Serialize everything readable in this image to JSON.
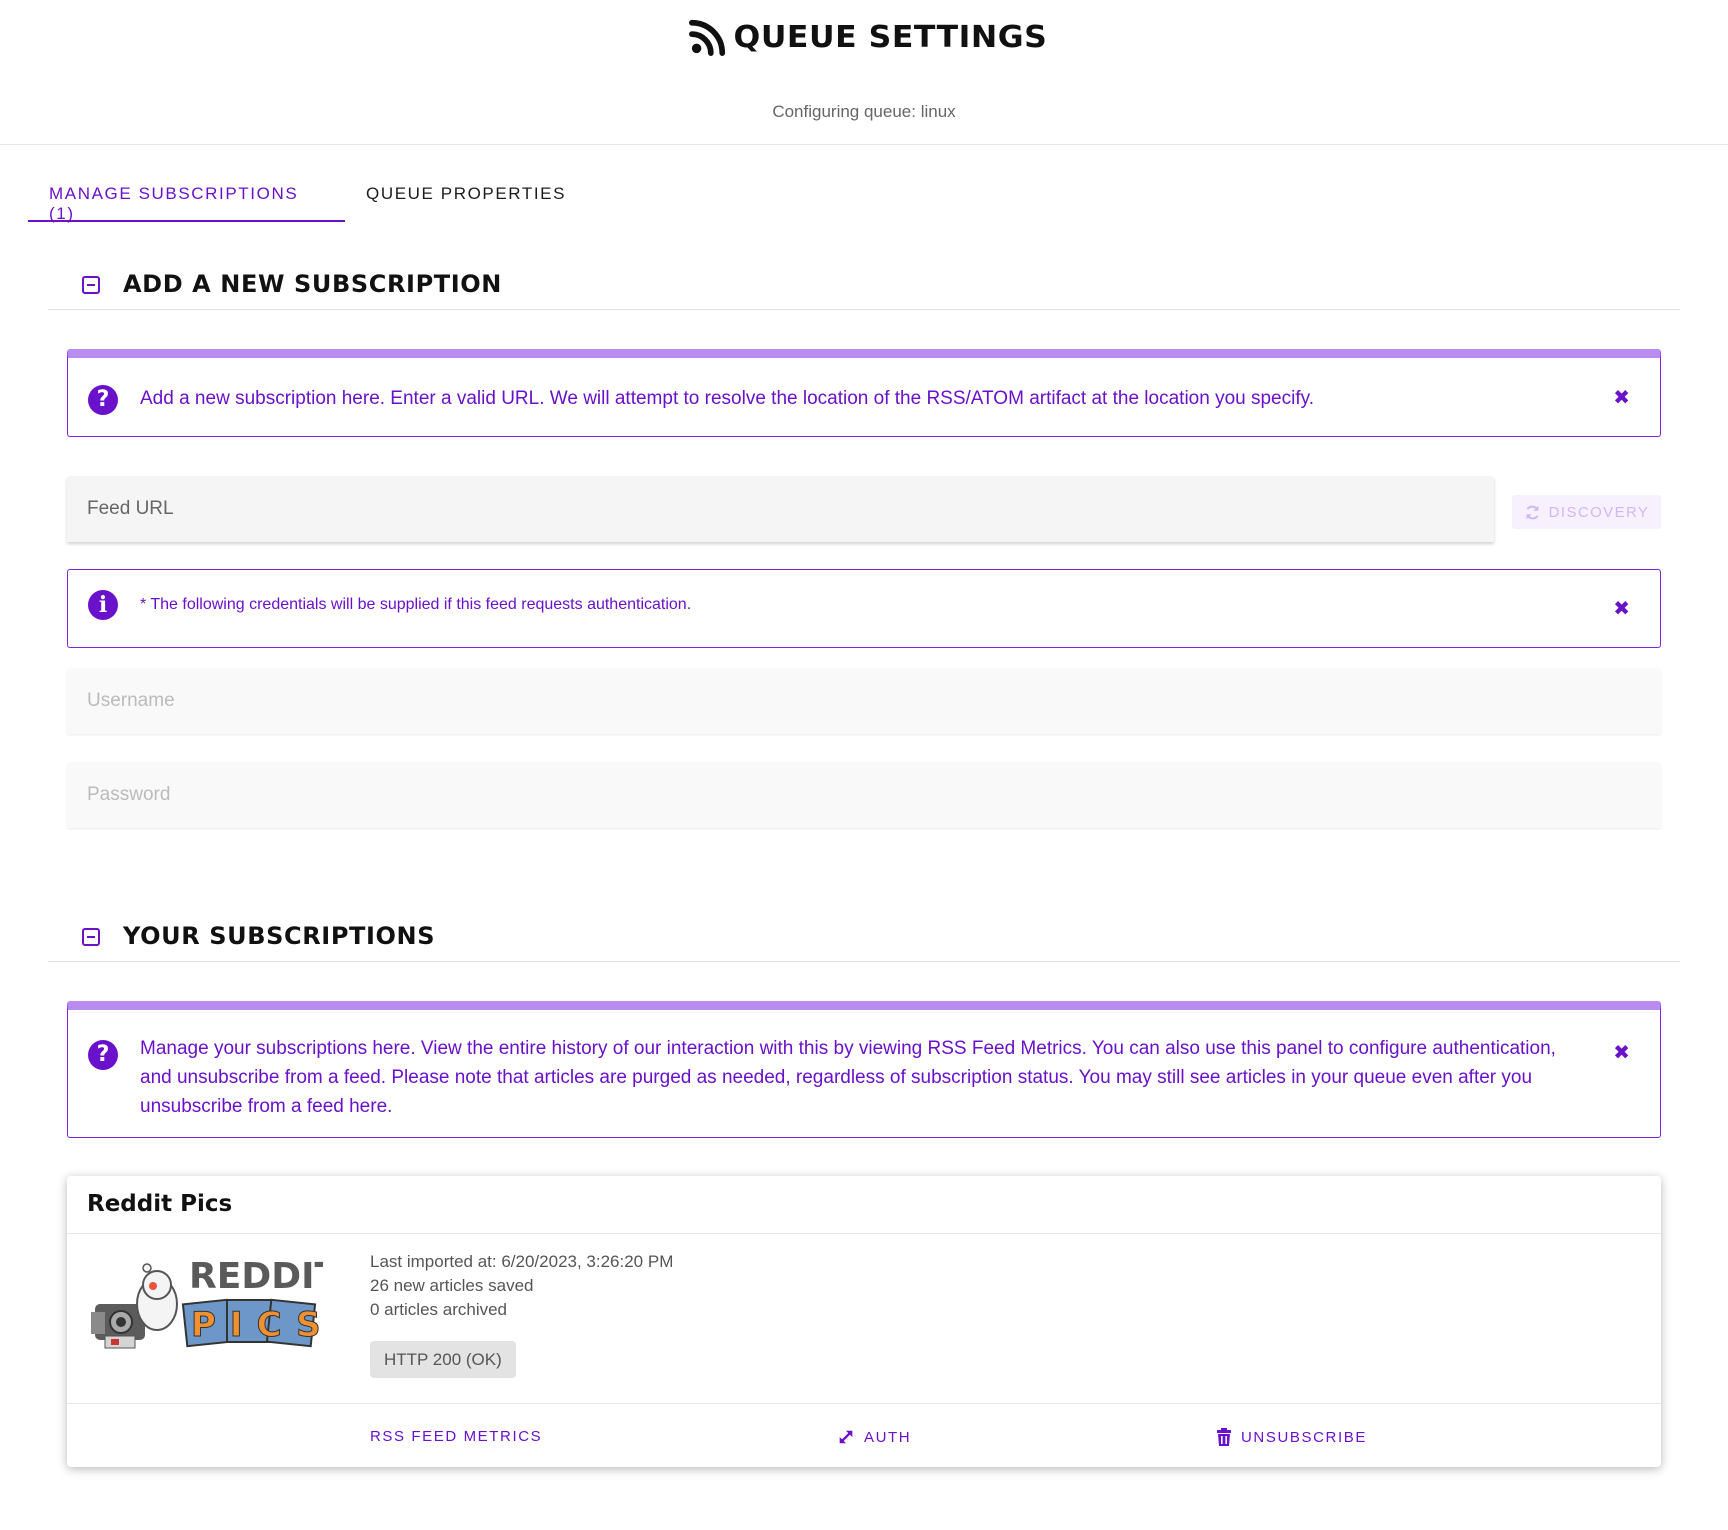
{
  "header": {
    "title": "QUEUE SETTINGS",
    "subtitle": "Configuring queue: linux"
  },
  "tabs": [
    {
      "label": "MANAGE SUBSCRIPTIONS (1)",
      "active": true
    },
    {
      "label": "QUEUE PROPERTIES",
      "active": false
    }
  ],
  "add_section": {
    "title": "ADD A NEW SUBSCRIPTION",
    "info_alert": "Add a new subscription here.  Enter a valid URL.  We will attempt to resolve the location of the RSS/ATOM artifact at the location you specify.",
    "feed_url_placeholder": "Feed URL",
    "discovery_label": "DISCOVERY",
    "cred_alert": "* The following credentials will be supplied if this feed requests authentication.",
    "username_placeholder": "Username",
    "password_placeholder": "Password"
  },
  "subs_section": {
    "title": "YOUR SUBSCRIPTIONS",
    "info_alert": "Manage your subscriptions here. View the entire history of our interaction with this by viewing RSS Feed Metrics. You can also use this panel to configure authentication, and unsubscribe from a feed. Please note that articles are purged as needed, regardless of subscription status. You may still see articles in your queue even after you unsubscribe from a feed here."
  },
  "subscription": {
    "title": "Reddit Pics",
    "logo_text_top": "REDDIT",
    "logo_text_bottom": "PICS",
    "last_imported": "Last imported at: 6/20/2023, 3:26:20 PM",
    "new_saved": "26 new articles saved",
    "archived": "0 articles archived",
    "status_chip": "HTTP 200 (OK)",
    "actions": {
      "metrics": "RSS FEED METRICS",
      "auth": "AUTH",
      "unsubscribe": "UNSUBSCRIBE"
    }
  },
  "colors": {
    "accent": "#6a11cb",
    "alert_bar": "#b98cf0",
    "chip_bg": "#e3e3e3"
  },
  "icons": [
    "rss-icon",
    "collapse-icon",
    "help-circle-icon",
    "close-icon",
    "info-circle-icon",
    "refresh-icon",
    "expand-arrows-icon",
    "trash-icon"
  ]
}
